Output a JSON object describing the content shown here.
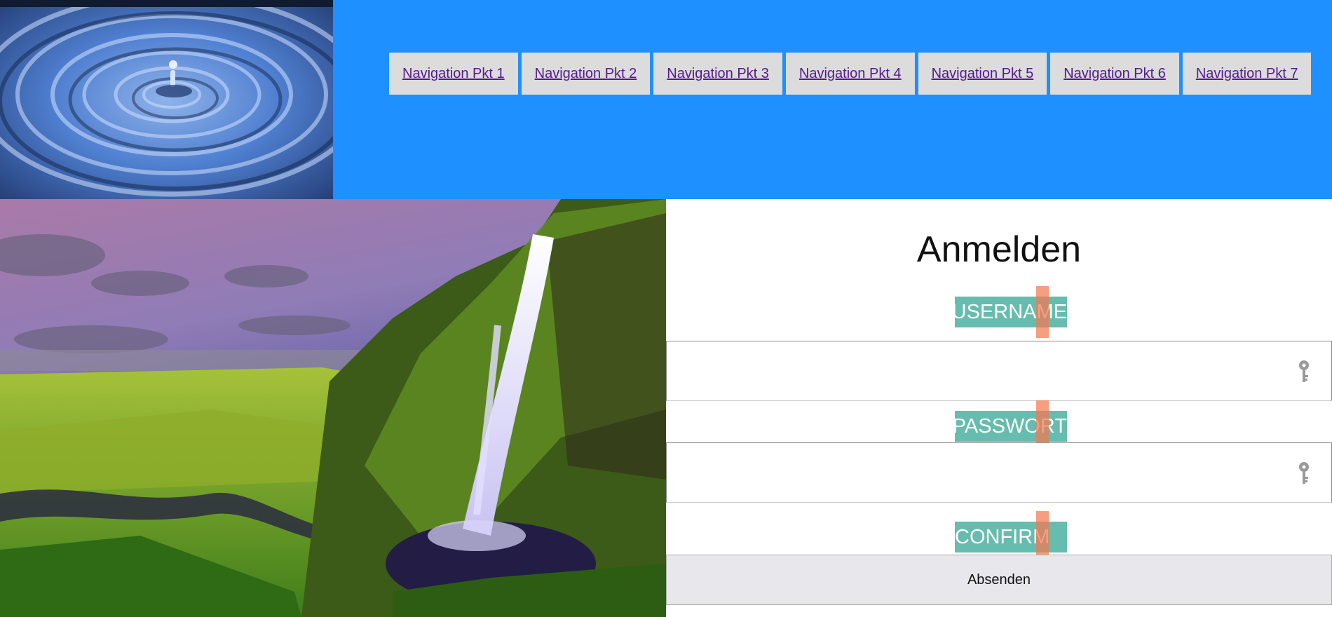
{
  "header": {
    "logo_alt": "water drop ripple",
    "nav_items": [
      {
        "label": "Navigation Pkt 1"
      },
      {
        "label": "Navigation Pkt 2"
      },
      {
        "label": "Navigation Pkt 3"
      },
      {
        "label": "Navigation Pkt 4"
      },
      {
        "label": "Navigation Pkt 5"
      },
      {
        "label": "Navigation Pkt 6"
      },
      {
        "label": "Navigation Pkt 7"
      }
    ],
    "background_color": "#1e90ff"
  },
  "hero": {
    "image_alt": "waterfall landscape"
  },
  "form": {
    "title": "Anmelden",
    "username_label": "USERNAME",
    "password_label": "PASSWORT",
    "confirm_label": "CONFIRM",
    "username_value": "",
    "password_value": "",
    "submit_label": "Absenden",
    "label_color": "#66bcae",
    "marker_color": "#f47850",
    "field_icon": "key-icon"
  }
}
